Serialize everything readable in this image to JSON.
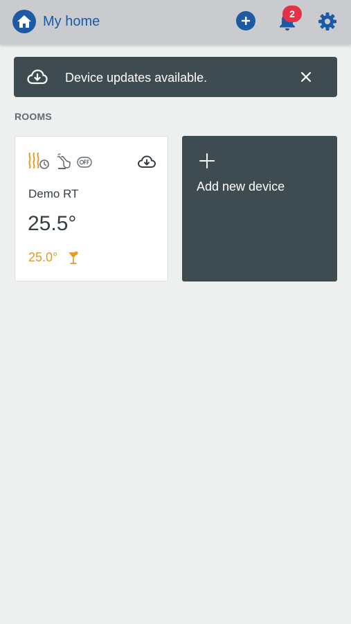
{
  "header": {
    "title": "My home",
    "home_icon": "home-icon",
    "add_icon": "add-circle-icon",
    "notifications_icon": "bell-icon",
    "notification_count": "2",
    "settings_icon": "gear-icon"
  },
  "banner": {
    "icon": "cloud-download-icon",
    "text": "Device updates available.",
    "close_icon": "close-icon"
  },
  "rooms": {
    "section_label": "ROOMS",
    "items": [
      {
        "name": "Demo RT",
        "current_temp": "25.5°",
        "setpoint": "25.0°",
        "status_icons": [
          "heating-schedule-icon",
          "manual-mode-icon",
          "off-icon"
        ],
        "update_icon": "cloud-download-icon",
        "mode_icon": "cocktail-icon"
      }
    ],
    "add_card": {
      "icon": "plus-icon",
      "label": "Add new device"
    }
  },
  "colors": {
    "brand_blue": "#1d5aa6",
    "topbar_bg": "#c9cbcf",
    "page_bg": "#eef0f0",
    "dark_card": "#3e4c52",
    "badge_red": "#e53146",
    "accent_orange": "#e49a25"
  }
}
